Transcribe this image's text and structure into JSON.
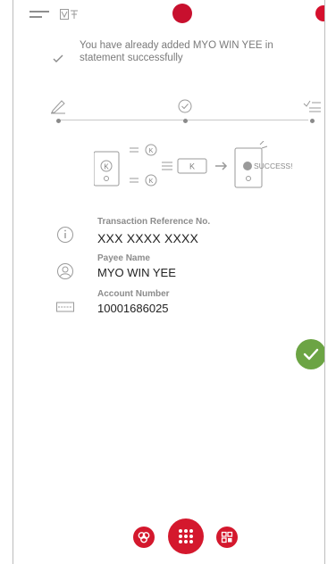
{
  "toast": {
    "message": "You have already added MYO WIN YEE in statement successfully"
  },
  "illustration": {
    "token_label": "K",
    "success_label": "SUCCESS!"
  },
  "details": [
    {
      "label": "Transaction Reference No.",
      "value": "XXX XXXX XXXX",
      "icon": "info-icon"
    },
    {
      "label": "Payee Name",
      "value": "MYO WIN YEE",
      "icon": "user-icon"
    },
    {
      "label": "Account Number",
      "value": "10001686025",
      "icon": "account-number-icon"
    }
  ],
  "colors": {
    "brand_red": "#d4182d",
    "success_green": "#6ca444"
  }
}
